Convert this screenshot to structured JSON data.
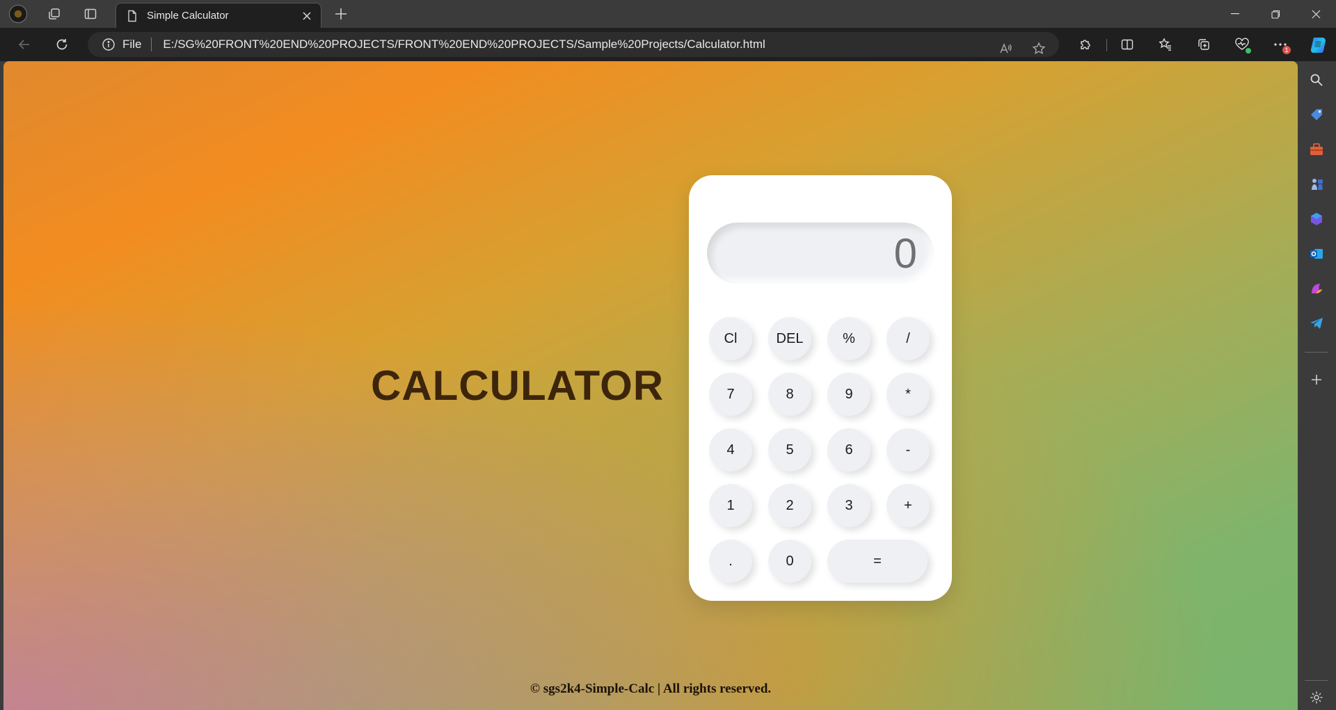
{
  "browser": {
    "tab_title": "Simple Calculator",
    "address_scheme_label": "File",
    "address_url": "E:/SG%20FRONT%20END%20PROJECTS/FRONT%20END%20PROJECTS/Sample%20Projects/Calculator.html",
    "notification_badge_count": "1",
    "accent_color": "#4a9eff"
  },
  "page": {
    "heading": "CALCULATOR",
    "footer": "© sgs2k4-Simple-Calc | All rights reserved.",
    "heading_color": "#3d250c"
  },
  "calculator": {
    "display_value": "0",
    "keys": {
      "clear": "Cl",
      "delete": "DEL",
      "percent": "%",
      "divide": "/",
      "seven": "7",
      "eight": "8",
      "nine": "9",
      "multiply": "*",
      "four": "4",
      "five": "5",
      "six": "6",
      "subtract": "-",
      "one": "1",
      "two": "2",
      "three": "3",
      "add": "+",
      "decimal": ".",
      "zero": "0",
      "equals": "="
    }
  },
  "sidebar": {
    "icons": [
      "search-icon",
      "shopping-tag-icon",
      "toolbox-icon",
      "chess-icon",
      "office-icon",
      "outlook-icon",
      "designer-icon",
      "telegram-icon",
      "add-icon",
      "settings-icon"
    ]
  }
}
